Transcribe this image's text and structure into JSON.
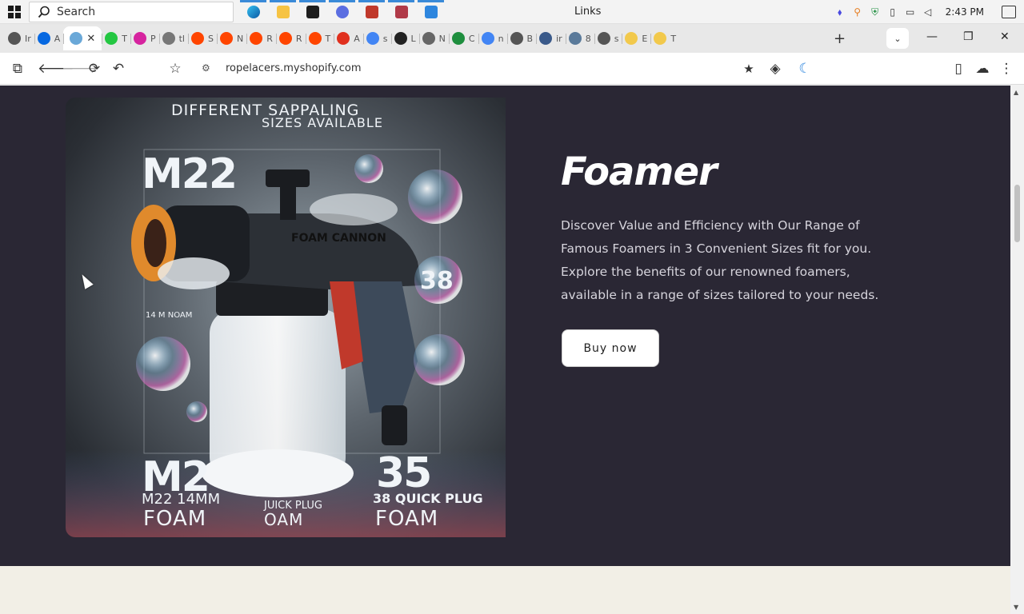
{
  "taskbar": {
    "search_label": "Search",
    "window_title": "Links",
    "clock": "2:43 PM"
  },
  "tabs": [
    {
      "letter": "Ir",
      "color": "#555"
    },
    {
      "letter": "A",
      "color": "#0668E1"
    },
    {
      "letter": "",
      "color": "#6aa8d8",
      "active": true
    },
    {
      "letter": "T",
      "color": "#24c742"
    },
    {
      "letter": "P",
      "color": "#d6249f"
    },
    {
      "letter": "tl",
      "color": "#777"
    },
    {
      "letter": "S",
      "color": "#ff4500"
    },
    {
      "letter": "N",
      "color": "#ff4500"
    },
    {
      "letter": "R",
      "color": "#ff4500"
    },
    {
      "letter": "R",
      "color": "#ff4500"
    },
    {
      "letter": "T",
      "color": "#ff4500"
    },
    {
      "letter": "A",
      "color": "#e0301e"
    },
    {
      "letter": "s",
      "color": "#4285F4"
    },
    {
      "letter": "L",
      "color": "#222"
    },
    {
      "letter": "N",
      "color": "#666"
    },
    {
      "letter": "C",
      "color": "#1e8e3e"
    },
    {
      "letter": "n",
      "color": "#4285F4"
    },
    {
      "letter": "B",
      "color": "#555"
    },
    {
      "letter": "ir",
      "color": "#3a5a8a"
    },
    {
      "letter": "8",
      "color": "#5a7a9a"
    },
    {
      "letter": "s",
      "color": "#555"
    },
    {
      "letter": "E",
      "color": "#f2c94c"
    },
    {
      "letter": "T",
      "color": "#f2c94c"
    }
  ],
  "toolbar": {
    "url": "ropelacers.myshopify.com"
  },
  "image_text": {
    "header_line1": "DIFFERENT SAPPALING",
    "header_line2": "SIZES    AVAILABLE",
    "m22": "M22",
    "cannon": "FOAM CANNON",
    "n38": "38",
    "left_small": "14 M NOAM",
    "m2": "M2",
    "n35": "35",
    "m22_14": "M22 14MM",
    "quick_plug": "JUICK PLUG",
    "quick_plug_38": "38 QUICK PLUG",
    "foam1": "FOAM",
    "foam2": "OAM",
    "foam3": "FOAM"
  },
  "product": {
    "title": "Foamer",
    "description": "Discover Value and Efficiency with Our Range of Famous Foamers in 3 Convenient Sizes fit for you. Explore the benefits of our renowned foamers, available in a range of sizes tailored to your needs.",
    "buy_label": "Buy now"
  }
}
